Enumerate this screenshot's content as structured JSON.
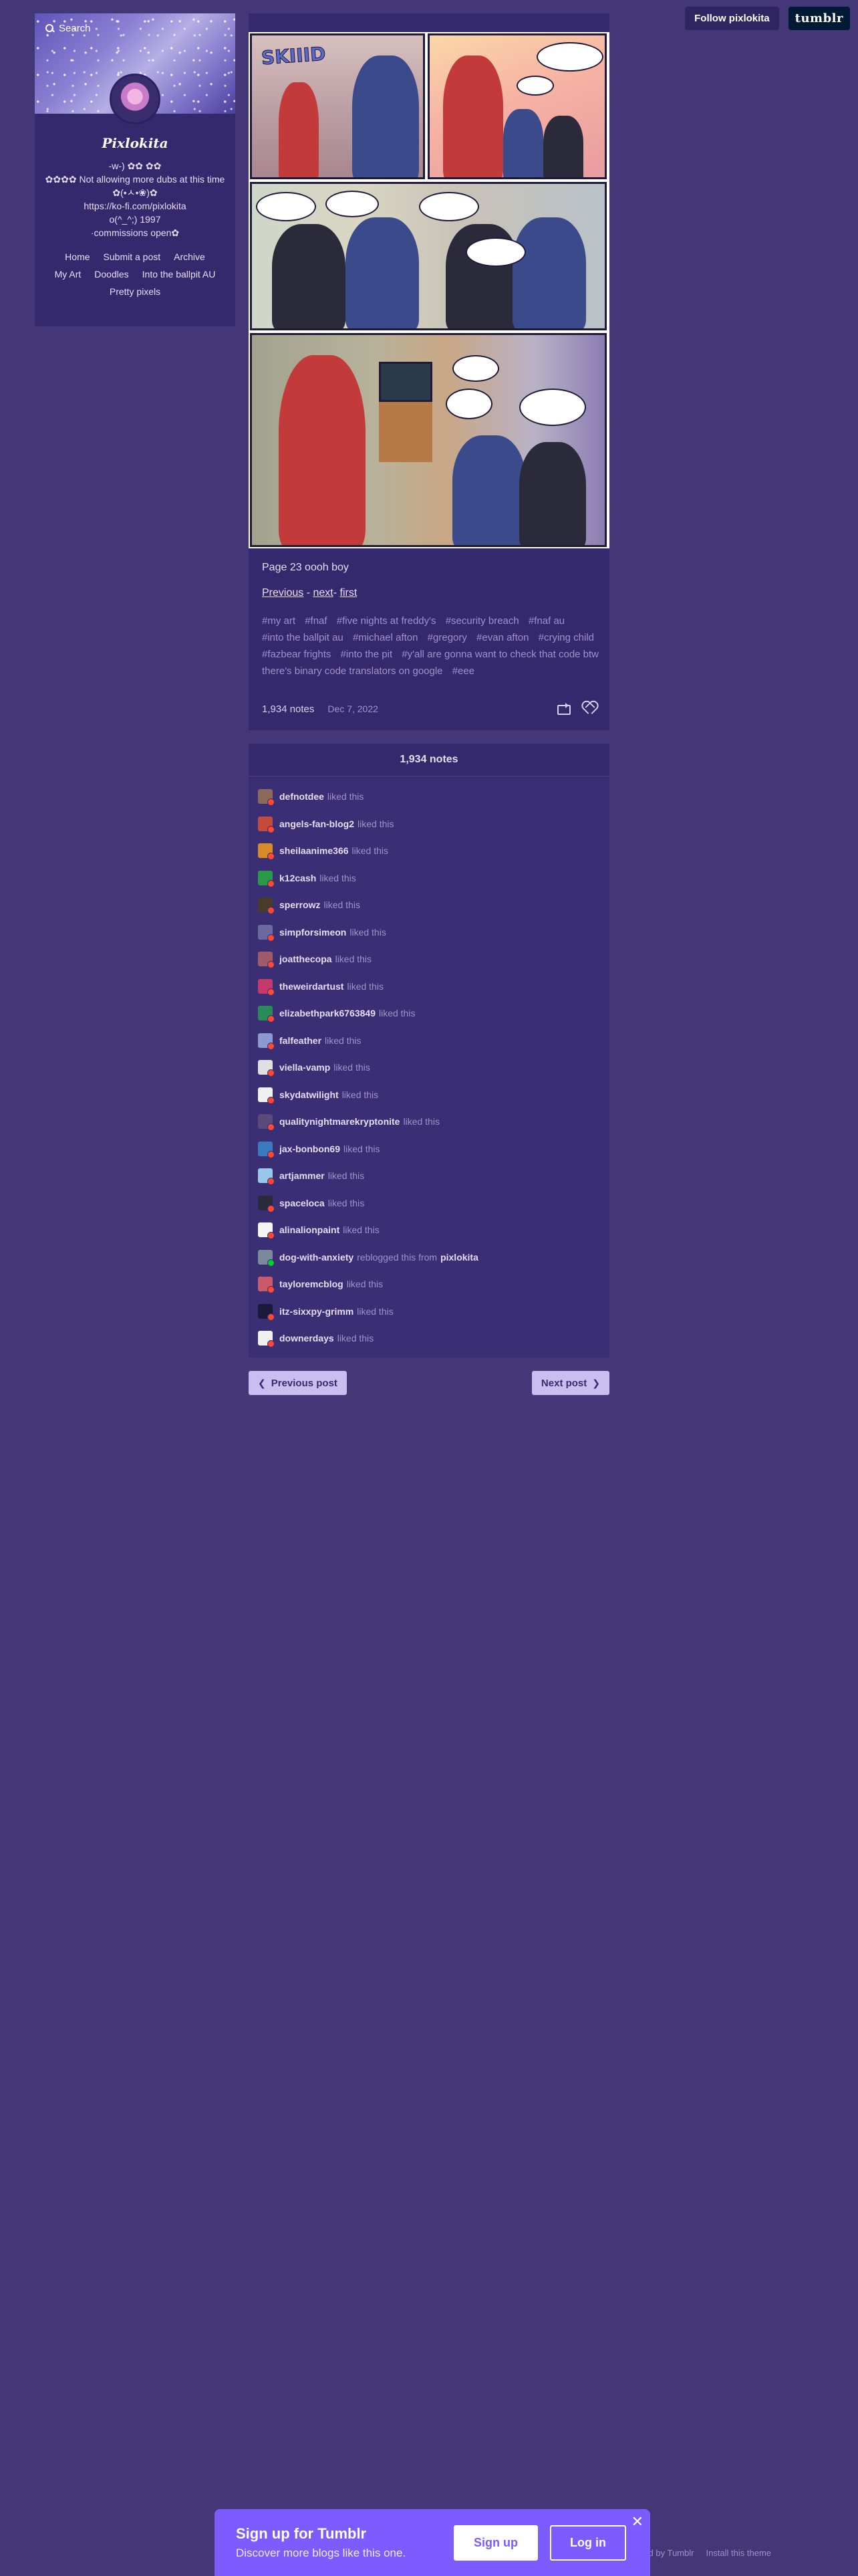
{
  "header": {
    "follow_label": "Follow pixlokita",
    "tumblr_label": "tumblr"
  },
  "sidebar": {
    "search_label": "Search",
    "blog_title": "Pixlokita",
    "desc_lines": [
      "-w-) ✿✿ ✿✿",
      "✿✿✿✿ Not allowing more dubs at this time",
      "✿(•ㅅ•❀)✿",
      "https://ko-fi.com/pixlokita",
      "o(^_^;) 1997",
      "·commissions open✿"
    ],
    "nav": [
      "Home",
      "Submit a post",
      "Archive",
      "My Art",
      "Doodles",
      "Into the ballpit AU",
      "Pretty pixels"
    ]
  },
  "post": {
    "comic_sfx": "SKIIID",
    "caption": "Page 23 oooh boy",
    "links": {
      "previous": "Previous",
      "sep1": " - ",
      "next": "next",
      "sep2": "- ",
      "first": "first"
    },
    "tags": [
      "#my art",
      "#fnaf",
      "#five nights at freddy's",
      "#security breach",
      "#fnaf au",
      "#into the ballpit au",
      "#michael afton",
      "#gregory",
      "#evan afton",
      "#crying child",
      "#fazbear frights",
      "#into the pit",
      "#y'all are gonna want to check that code btw there's binary code translators on google",
      "#eee"
    ],
    "notes_count": "1,934 notes",
    "date": "Dec 7, 2022"
  },
  "notes": {
    "header": "1,934 notes",
    "items": [
      {
        "user": "defnotdee",
        "action": "liked this",
        "color": "#8a6a5a"
      },
      {
        "user": "angels-fan-blog2",
        "action": "liked this",
        "color": "#c44a3a"
      },
      {
        "user": "sheilaanime366",
        "action": "liked this",
        "color": "#d78a2a"
      },
      {
        "user": "k12cash",
        "action": "liked this",
        "color": "#2a9a4a"
      },
      {
        "user": "sperrowz",
        "action": "liked this",
        "color": "#4a3a2a"
      },
      {
        "user": "simpforsimeon",
        "action": "liked this",
        "color": "#6a6aa0"
      },
      {
        "user": "joatthecopa",
        "action": "liked this",
        "color": "#a05a6a"
      },
      {
        "user": "theweirdartust",
        "action": "liked this",
        "color": "#c43a6a"
      },
      {
        "user": "elizabethpark6763849",
        "action": "liked this",
        "color": "#2a8a5a"
      },
      {
        "user": "falfeather",
        "action": "liked this",
        "color": "#8a9ad0"
      },
      {
        "user": "viella-vamp",
        "action": "liked this",
        "color": "#e0e0e0"
      },
      {
        "user": "skydatwilight",
        "action": "liked this",
        "color": "#f0f0f0"
      },
      {
        "user": "qualitynightmarekryptonite",
        "action": "liked this",
        "color": "#5a4a7a"
      },
      {
        "user": "jax-bonbon69",
        "action": "liked this",
        "color": "#3a7ac0"
      },
      {
        "user": "artjammer",
        "action": "liked this",
        "color": "#9ac8e8"
      },
      {
        "user": "spaceloca",
        "action": "liked this",
        "color": "#2a2a3a"
      },
      {
        "user": "alinalionpaint",
        "action": "liked this",
        "color": "#f4f4f4"
      },
      {
        "user": "dog-with-anxiety",
        "action": "reblogged this from",
        "from": "pixlokita",
        "color": "#7a8a9a",
        "reblog": true
      },
      {
        "user": "tayloremcblog",
        "action": "liked this",
        "color": "#c85a6a"
      },
      {
        "user": "itz-sixxpy-grimm",
        "action": "liked this",
        "color": "#1a1a3a"
      },
      {
        "user": "downerdays",
        "action": "liked this",
        "color": "#f0f0f0"
      }
    ]
  },
  "pager": {
    "prev": "Previous post",
    "next": "Next post"
  },
  "footer": {
    "powered": "Powered by Tumblr",
    "install": "Install this theme"
  },
  "signup": {
    "title": "Sign up for Tumblr",
    "subtitle": "Discover more blogs like this one.",
    "signup_label": "Sign up",
    "login_label": "Log in"
  }
}
